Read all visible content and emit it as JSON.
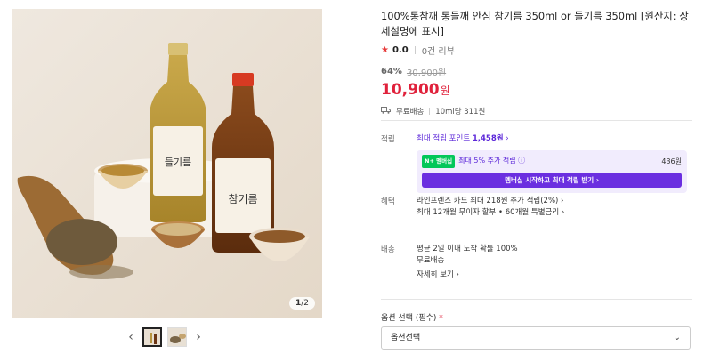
{
  "product": {
    "title": "100%통참깨 통들깨 안심 참기름 350ml or 들기름 350ml [원산지: 상세설명에 표시]",
    "rating_score": "0.0",
    "review_count": "0건 리뷰",
    "discount_rate": "64%",
    "original_price": "30,900원",
    "sale_price": "10,900",
    "sale_price_unit": "원",
    "shipping": "무료배송",
    "unit_price": "10ml당 311원",
    "bottle_left_label": "들기름",
    "bottle_right_label": "참기름"
  },
  "gallery": {
    "counter_current": "1",
    "counter_total": "/2",
    "prev_icon": "‹",
    "next_icon": "›"
  },
  "points": {
    "label": "적립",
    "link_prefix": "최대 적립 포인트 ",
    "link_amount": "1,458원",
    "link_chevron": " ›",
    "promo_badge": "N+ 멤버십",
    "promo_text": "최대 5% 추가 적립",
    "promo_info": " ⓘ",
    "promo_amount": "436원",
    "promo_button": "멤버십 시작하고 최대 적립 받기 ›"
  },
  "benefits": {
    "label": "혜택",
    "line1": "라인프렌즈 카드 최대 218원 추가 적립(2%) ›",
    "line2": "최대 12개월 무이자 할부 • 60개월 특별금리 ›"
  },
  "delivery": {
    "label": "배송",
    "line1": "평균 2일 이내 도착 확률 100%",
    "line2": "무료배송",
    "details_link": "자세히 보기",
    "details_chevron": " ›"
  },
  "options": {
    "label": "옵션 선택 (필수)",
    "required_mark": " *",
    "select_value": "옵션선택",
    "select_chevron": "⌄"
  },
  "colors": {
    "sale_red": "#e0213b",
    "purple": "#5c27d9",
    "naver_green": "#03c75a"
  }
}
